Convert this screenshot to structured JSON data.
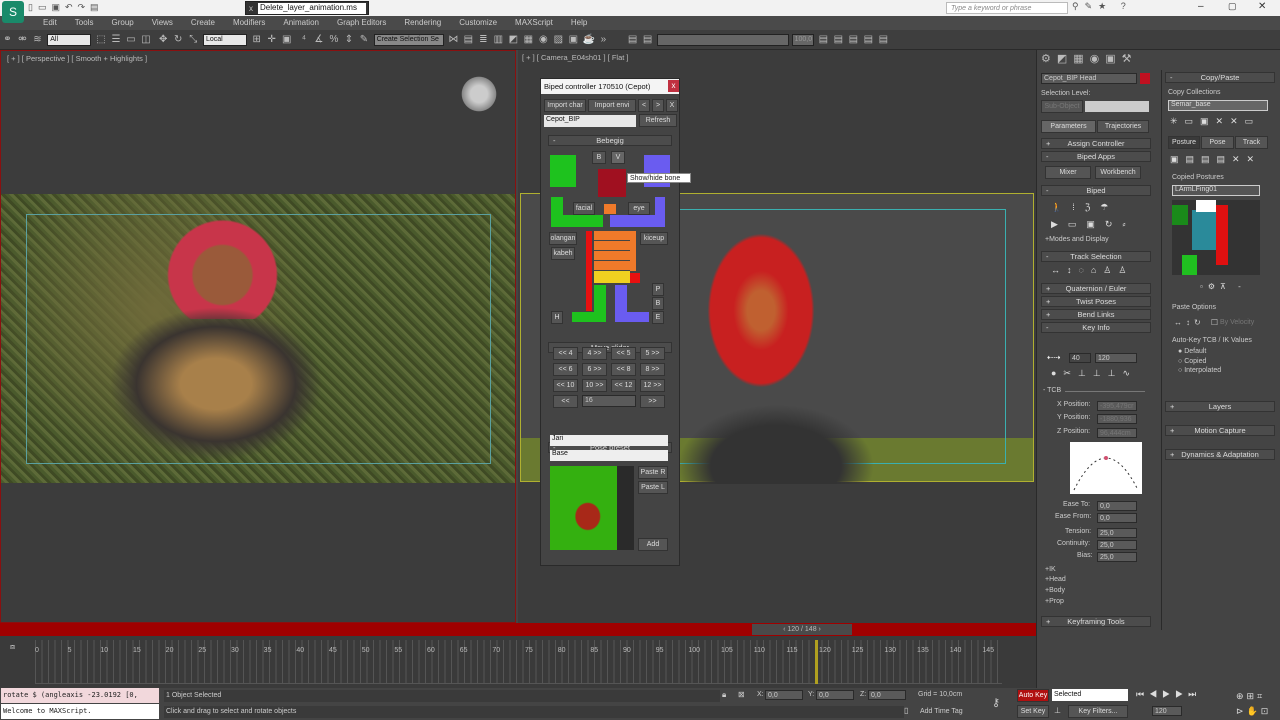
{
  "titlebar": {
    "script_file": "Delete_layer_animation.ms",
    "search_placeholder": "Type a keyword or phrase",
    "close": "x"
  },
  "menu": [
    "Edit",
    "Tools",
    "Group",
    "Views",
    "Create",
    "Modifiers",
    "Animation",
    "Graph Editors",
    "Rendering",
    "Customize",
    "MAXScript",
    "Help"
  ],
  "toolbar": {
    "filter": "All",
    "coord": "Local",
    "selection_set": "Create Selection Se",
    "percent": "100,0"
  },
  "viewports": {
    "left_label": "[ + ] [ Perspective ] [ Smooth + Highlights ]",
    "right_label": "[ + ] [ Camera_E04sh01 ] [ Flat ]"
  },
  "biped_dialog": {
    "title": "Biped controller 170510 (Cepot)",
    "close": "x",
    "import_char": "Import char",
    "import_envi": "Import envi",
    "prev": "<",
    "next": ">",
    "x": "X",
    "character": "Cepot_BIP",
    "refresh": "Refresh",
    "bebegig": "Bebegig",
    "b_btn": "B",
    "v_btn": "V",
    "tooltip": "Show/hide bone",
    "facial": "facial",
    "eye": "eye",
    "olangan": "olangan",
    "kabeh": "kabeh",
    "kiceup": "kiceup",
    "p": "P",
    "bb": "B",
    "e": "E",
    "h": "H",
    "move_slider": "Move slider",
    "slider_buttons": [
      [
        "<< 4",
        "4 >>",
        "<< 5",
        "5 >>"
      ],
      [
        "<< 6",
        "6 >>",
        "<< 8",
        "8 >>"
      ],
      [
        "<< 10",
        "10 >>",
        "<< 12",
        "12 >>"
      ]
    ],
    "left": "<<",
    "right": ">>",
    "slider_value": "16",
    "pose_preset": "Pose preset",
    "preset_group": "Jari",
    "preset_name": "Base",
    "paste_r": "Paste R",
    "paste_l": "Paste L",
    "add": "Add"
  },
  "command_panel": {
    "object_name": "Cepot_BIP Head",
    "selection_level": "Selection Level:",
    "sub_object": "Sub-Object",
    "parameters": "Parameters",
    "trajectories": "Trajectories",
    "assign_controller": "Assign Controller",
    "biped_apps": "Biped Apps",
    "mixer": "Mixer",
    "workbench": "Workbench",
    "biped": "Biped",
    "modes_display": "+Modes and Display",
    "track_selection": "Track Selection",
    "quaternion": "Quaternion / Euler",
    "twist_poses": "Twist Poses",
    "bend_links": "Bend Links",
    "key_info": "Key Info",
    "key_num": "40",
    "key_frame": "120",
    "tcb": "- TCB",
    "x_pos_label": "X Position:",
    "x_pos": "-395,479cr",
    "y_pos_label": "Y Position:",
    "y_pos": "-1880,936",
    "z_pos_label": "Z Position:",
    "z_pos": "96,444cm",
    "ease_to_label": "Ease To:",
    "ease_to": "0,0",
    "ease_from_label": "Ease From:",
    "ease_from": "0,0",
    "tension_label": "Tension:",
    "tension": "25,0",
    "continuity_label": "Continuity:",
    "continuity": "25,0",
    "bias_label": "Bias:",
    "bias": "25,0",
    "ik": "+IK",
    "head": "+Head",
    "body": "+Body",
    "prop": "+Prop",
    "keyframing_tools": "Keyframing Tools",
    "copy_paste": "Copy/Paste",
    "copy_collections": "Copy Collections",
    "collection": "Semar_base",
    "posture": "Posture",
    "pose": "Pose",
    "track": "Track",
    "copied_postures": "Copied Postures",
    "posture_name": "LArmLFing01",
    "paste_options": "Paste Options",
    "by_velocity": "By Velocity",
    "autokey_label": "Auto-Key TCB / IK Values",
    "radio": [
      "Default",
      "Copied",
      "Interpolated"
    ],
    "layers": "Layers",
    "motion_capture": "Motion Capture",
    "dynamics": "Dynamics & Adaptation"
  },
  "timeline": {
    "frame_counter": "120 / 148",
    "ticks": [
      "0",
      "5",
      "10",
      "15",
      "20",
      "25",
      "30",
      "35",
      "40",
      "45",
      "50",
      "55",
      "60",
      "65",
      "70",
      "75",
      "80",
      "85",
      "90",
      "95",
      "100",
      "105",
      "110",
      "115",
      "120",
      "125",
      "130",
      "135",
      "140",
      "145"
    ],
    "current": 120,
    "total": 148
  },
  "status": {
    "script_line": "rotate $ (angleaxis -23.0192 [0,",
    "welcome": "Welcome to MAXScript.",
    "selected": "1 Object Selected",
    "prompt": "Click and drag to select and rotate objects",
    "x": "0,0",
    "y": "0,0",
    "z": "0,0",
    "grid": "Grid = 10,0cm",
    "add_time_tag": "Add Time Tag",
    "auto_key": "Auto Key",
    "key_mode": "Selected",
    "set_key": "Set Key",
    "key_filters": "Key Filters...",
    "frame": "120"
  }
}
